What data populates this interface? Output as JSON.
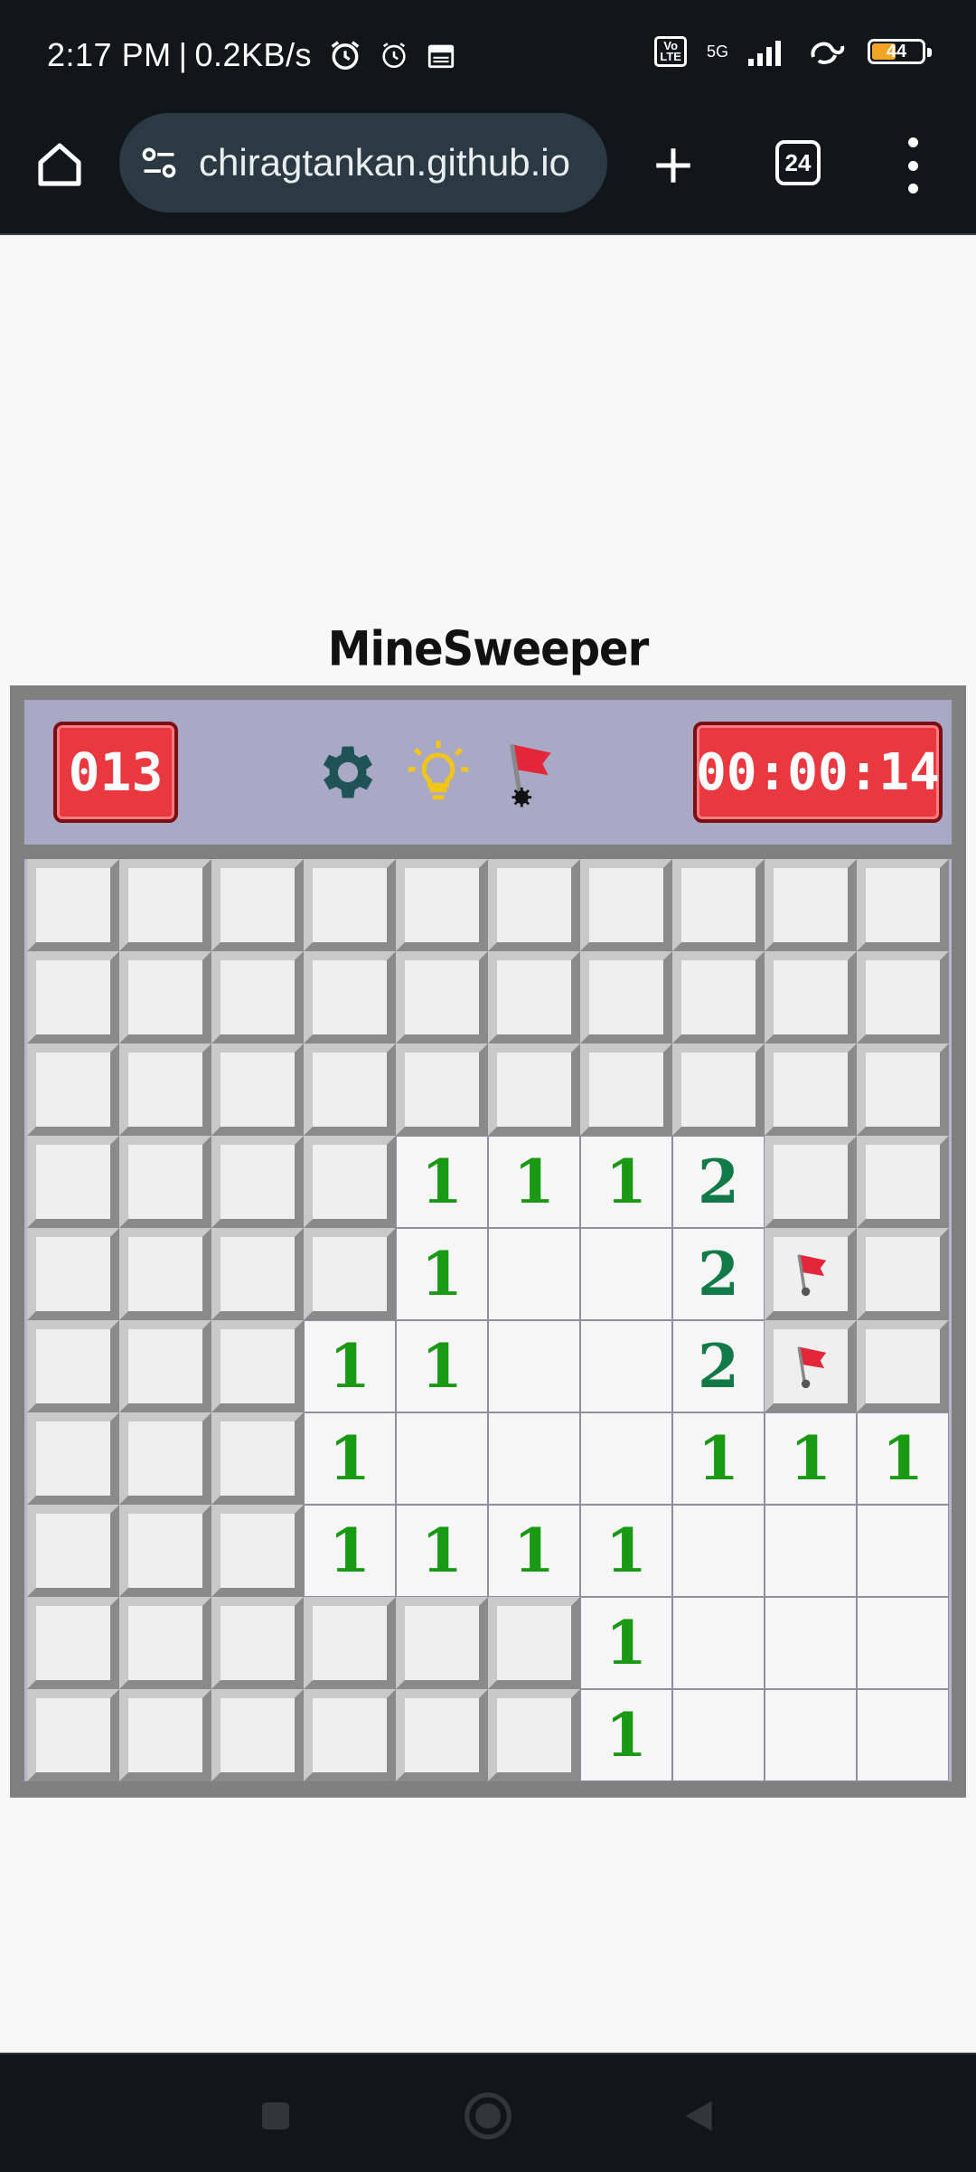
{
  "status_bar": {
    "time": "2:17 PM",
    "separator": "|",
    "speed": "0.2KB/s",
    "network": "5G",
    "volte": "Vo\nLTE",
    "battery_level": "44"
  },
  "browser": {
    "url": "chiragtankan.github.io",
    "tab_count": "24"
  },
  "game": {
    "title": "MineSweeper",
    "mines_remaining": "013",
    "timer": "00:00:14",
    "board": [
      [
        "H",
        "H",
        "H",
        "H",
        "H",
        "H",
        "H",
        "H",
        "H",
        "H"
      ],
      [
        "H",
        "H",
        "H",
        "H",
        "H",
        "H",
        "H",
        "H",
        "H",
        "H"
      ],
      [
        "H",
        "H",
        "H",
        "H",
        "H",
        "H",
        "H",
        "H",
        "H",
        "H"
      ],
      [
        "H",
        "H",
        "H",
        "H",
        "1",
        "1",
        "1",
        "2",
        "H",
        "H"
      ],
      [
        "H",
        "H",
        "H",
        "H",
        "1",
        "",
        "",
        "2",
        "F",
        "H"
      ],
      [
        "H",
        "H",
        "H",
        "1",
        "1",
        "",
        "",
        "2",
        "F",
        "H"
      ],
      [
        "H",
        "H",
        "H",
        "1",
        "",
        "",
        "",
        "1",
        "1",
        "1"
      ],
      [
        "H",
        "H",
        "H",
        "1",
        "1",
        "1",
        "1",
        "",
        "",
        ""
      ],
      [
        "H",
        "H",
        "H",
        "H",
        "H",
        "H",
        "1",
        "",
        "",
        ""
      ],
      [
        "H",
        "H",
        "H",
        "H",
        "H",
        "H",
        "1",
        "",
        "",
        ""
      ]
    ]
  },
  "colors": {
    "board_frame": "#808080",
    "header_panel": "#a9a9c6",
    "counter_red": "#ea3840",
    "number_1": "#1a9a14",
    "number_2": "#117a47"
  },
  "icons": {
    "home": "home-icon",
    "site_settings": "tune-icon",
    "new_tab": "plus-icon",
    "menu": "more-vert-icon",
    "settings": "gear-icon",
    "hint": "lightbulb-icon",
    "flag": "flag-icon"
  }
}
